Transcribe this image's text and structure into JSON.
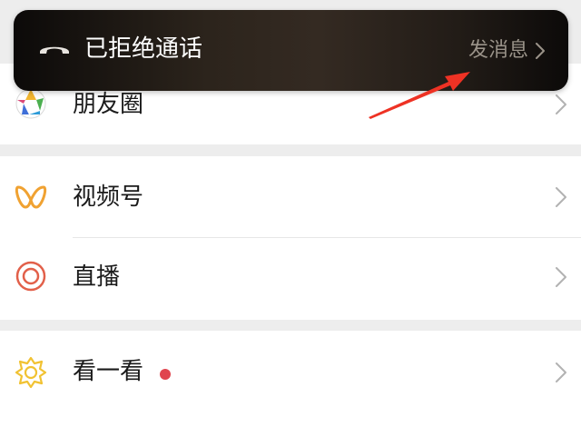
{
  "banner": {
    "title": "已拒绝通话",
    "action_label": "发消息",
    "icon": "hang-up-phone-icon",
    "action_icon": "chevron-right-icon"
  },
  "menu": {
    "moments": {
      "label": "朋友圈",
      "icon": "moments-aperture-icon"
    },
    "channels": {
      "label": "视频号",
      "icon": "channels-icon"
    },
    "live": {
      "label": "直播",
      "icon": "live-ring-icon"
    },
    "top_stories": {
      "label": "看一看",
      "icon": "top-stories-icon",
      "badge_color": "#e0454f"
    }
  },
  "colors": {
    "channels": "#f0a232",
    "live": "#e2604a",
    "top_stories": "#f1c232",
    "annotation_arrow": "#ee3224"
  }
}
